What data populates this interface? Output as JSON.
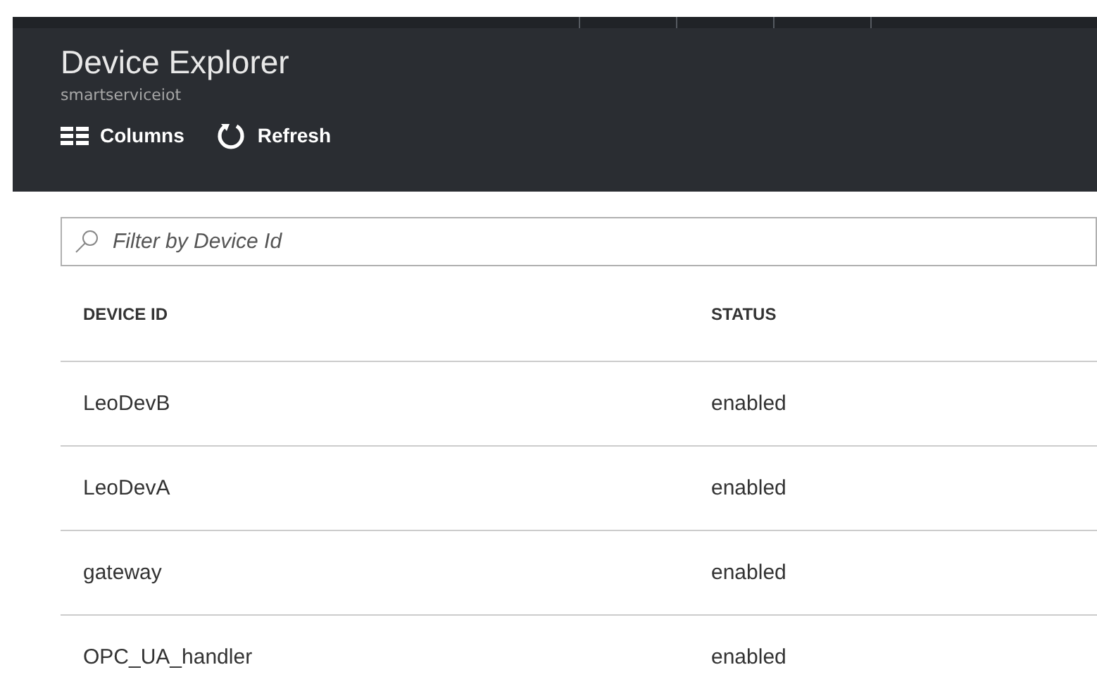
{
  "header": {
    "title": "Device Explorer",
    "subtitle": "smartserviceiot"
  },
  "toolbar": [
    {
      "kind": "columns",
      "label": "Columns"
    },
    {
      "kind": "refresh",
      "label": "Refresh"
    }
  ],
  "filter": {
    "placeholder": "Filter by Device Id"
  },
  "table": {
    "columns": [
      "DEVICE ID",
      "STATUS"
    ],
    "rows": [
      [
        "LeoDevB",
        "enabled"
      ],
      [
        "LeoDevA",
        "enabled"
      ],
      [
        "gateway",
        "enabled"
      ],
      [
        "OPC_UA_handler",
        "enabled"
      ]
    ]
  }
}
